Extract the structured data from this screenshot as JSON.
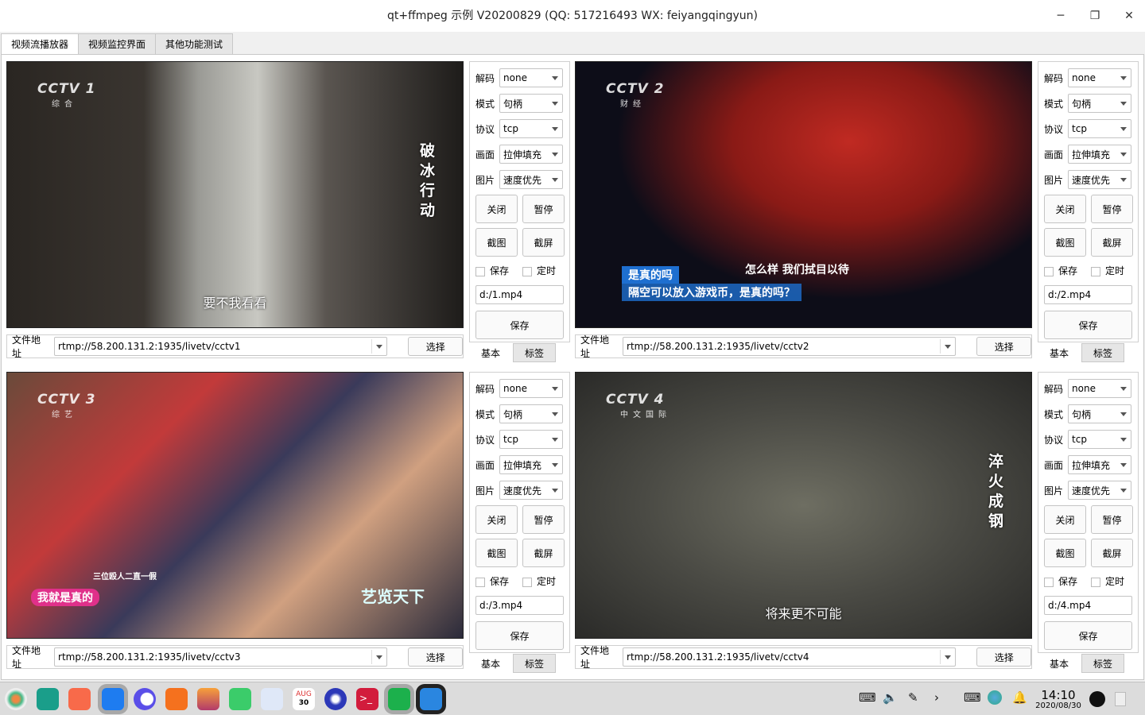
{
  "window": {
    "title": "qt+ffmpeg 示例 V20200829 (QQ: 517216493 WX: feiyangqingyun)",
    "minimize": "─",
    "maximize": "❐",
    "close": "✕"
  },
  "tabs": [
    {
      "label": "视频流播放器",
      "active": true
    },
    {
      "label": "视频监控界面"
    },
    {
      "label": "其他功能测试"
    }
  ],
  "labels": {
    "decode": "解码",
    "mode": "模式",
    "protocol": "协议",
    "screen": "画面",
    "image": "图片",
    "close": "关闭",
    "pause": "暂停",
    "snap": "截图",
    "screenshot": "截屏",
    "save_chk": "保存",
    "timer_chk": "定时",
    "save_btn": "保存",
    "tab_basic": "基本",
    "tab_label": "标签",
    "file_addr": "文件地址",
    "select": "选择"
  },
  "players": [
    {
      "url": "rtmp://58.200.131.2:1935/livetv/cctv1",
      "decode": "none",
      "mode": "句柄",
      "protocol": "tcp",
      "screen": "拉伸填充",
      "image": "速度优先",
      "save_path": "d:/1.mp4",
      "logo": "CCTV 1",
      "logo_sub": "综合",
      "subtitle": "要不我看看",
      "vtitle": "破冰行动",
      "captions": []
    },
    {
      "url": "rtmp://58.200.131.2:1935/livetv/cctv2",
      "decode": "none",
      "mode": "句柄",
      "protocol": "tcp",
      "screen": "拉伸填充",
      "image": "速度优先",
      "save_path": "d:/2.mp4",
      "logo": "CCTV 2",
      "logo_sub": "财经",
      "subtitle": "",
      "vtitle": "",
      "captions": [
        "是真的吗",
        "怎么样 我们拭目以待",
        "隔空可以放入游戏币，是真的吗？"
      ]
    },
    {
      "url": "rtmp://58.200.131.2:1935/livetv/cctv3",
      "decode": "none",
      "mode": "句柄",
      "protocol": "tcp",
      "screen": "拉伸填充",
      "image": "速度优先",
      "save_path": "d:/3.mp4",
      "logo": "CCTV 3",
      "logo_sub": "综艺",
      "subtitle": "",
      "vtitle": "",
      "captions": [
        "我就是真的",
        "三位殴人二直一假",
        "艺览天下"
      ]
    },
    {
      "url": "rtmp://58.200.131.2:1935/livetv/cctv4",
      "decode": "none",
      "mode": "句柄",
      "protocol": "tcp",
      "screen": "拉伸填充",
      "image": "速度优先",
      "save_path": "d:/4.mp4",
      "logo": "CCTV 4",
      "logo_sub": "中文国际",
      "subtitle": "将来更不可能",
      "vtitle": "淬火成钢",
      "captions": []
    }
  ],
  "taskbar": {
    "time": "14:10",
    "date": "2020/08/30",
    "calendar_day": "30",
    "calendar_month": "AUG"
  }
}
